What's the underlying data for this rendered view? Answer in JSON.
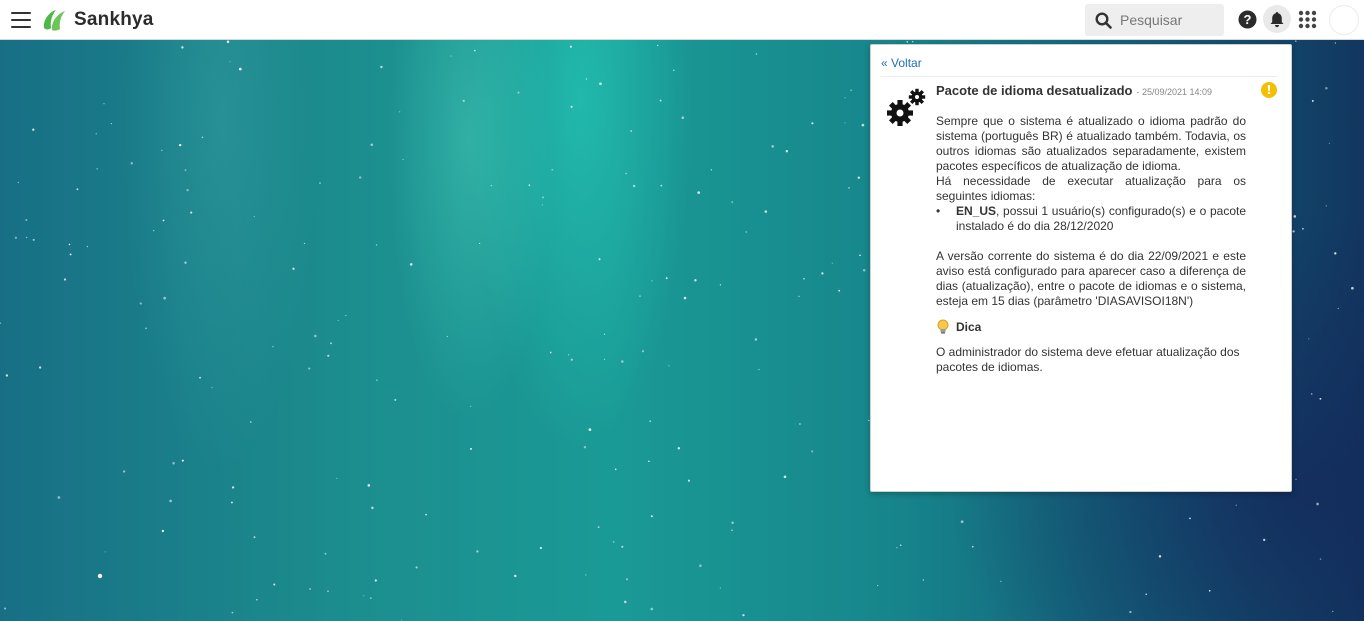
{
  "header": {
    "brand": "Sankhya",
    "search_placeholder": "Pesquisar",
    "icons": [
      "menu-icon",
      "sankhya-logo-icon",
      "search-icon",
      "help-icon",
      "bell-icon",
      "apps-grid-icon",
      "avatar"
    ]
  },
  "colors": {
    "brand_green": "#4cb848",
    "link_blue": "#1d6fb8",
    "warning_yellow": "#f2c000"
  },
  "notification": {
    "back_label": "« Voltar",
    "title": "Pacote de idioma desatualizado",
    "date": "- 25/09/2021 14:09",
    "paragraph1": "Sempre que o sistema é atualizado o idioma padrão do sistema (português BR) é atualizado também. Todavia, os outros idiomas são atualizados separadamente, existem pacotes específicos de atualização de idioma.",
    "paragraph2": "Há necessidade de executar atualização para os seguintes idiomas:",
    "bullet_lang": "EN_US",
    "bullet_text": ", possui 1 usuário(s) configurado(s) e o pacote instalado é do dia 28/12/2020",
    "paragraph3": "A versão corrente do sistema é do dia 22/09/2021 e este aviso está configurado para aparecer caso a diferença de dias (atualização), entre o pacote de idiomas e o sistema, esteja em 15 dias (parâmetro 'DIASAVISOI18N')",
    "tip_title": "Dica",
    "tip_text": "O administrador do sistema deve efetuar atualização dos pacotes de idiomas.",
    "warning_symbol": "!"
  }
}
